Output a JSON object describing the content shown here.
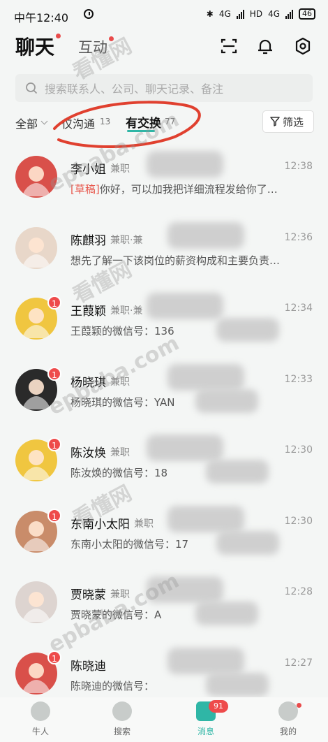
{
  "status": {
    "time": "中午12:40",
    "network1": "4G",
    "network2": "4G",
    "hd": "HD",
    "battery": "46"
  },
  "header": {
    "tab_chat": "聊天",
    "tab_interact": "互动"
  },
  "search": {
    "placeholder": "搜索联系人、公司、聊天记录、备注"
  },
  "filters": {
    "all": "全部",
    "only_chat": "仅沟通",
    "only_chat_count": "13",
    "exchanged": "有交换",
    "exchanged_count": "77",
    "filter_btn": "筛选"
  },
  "conversations": [
    {
      "name": "李小姐",
      "job": "兼职",
      "time": "12:38",
      "draft": "[草稿]",
      "message": "你好，可以加我把详细流程发给你了…",
      "badge": ""
    },
    {
      "name": "陈麒羽",
      "job": "兼职·兼",
      "time": "12:36",
      "draft": "",
      "message": "想先了解一下该岗位的薪资构成和主要负责…",
      "badge": ""
    },
    {
      "name": "王葭颖",
      "job": "兼职·兼",
      "time": "12:34",
      "draft": "",
      "message": "王葭颖的微信号：136",
      "badge": "1"
    },
    {
      "name": "杨晓琪",
      "job": "兼职",
      "time": "12:33",
      "draft": "",
      "message": "杨晓琪的微信号：YAN",
      "badge": "1"
    },
    {
      "name": "陈汝焕",
      "job": "兼职",
      "time": "12:30",
      "draft": "",
      "message": "陈汝焕的微信号：18",
      "badge": "1"
    },
    {
      "name": "东南小太阳",
      "job": "兼职",
      "time": "12:30",
      "draft": "",
      "message": "东南小太阳的微信号：17",
      "badge": "1"
    },
    {
      "name": "贾晓蒙",
      "job": "兼职",
      "time": "12:28",
      "draft": "",
      "message": "贾晓蒙的微信号：A",
      "badge": ""
    },
    {
      "name": "陈晓迪",
      "job": "",
      "time": "12:27",
      "draft": "",
      "message": "陈晓迪的微信号：",
      "badge": "1"
    }
  ],
  "tabbar": {
    "niuren": "牛人",
    "search": "搜索",
    "messages": "消息",
    "messages_badge": "91",
    "mine": "我的"
  },
  "watermark": [
    "看懂网",
    "epbaba.com"
  ],
  "colors": {
    "accent": "#2fb6a6",
    "badge": "#ee4b4b",
    "draft": "#e85a4f"
  }
}
